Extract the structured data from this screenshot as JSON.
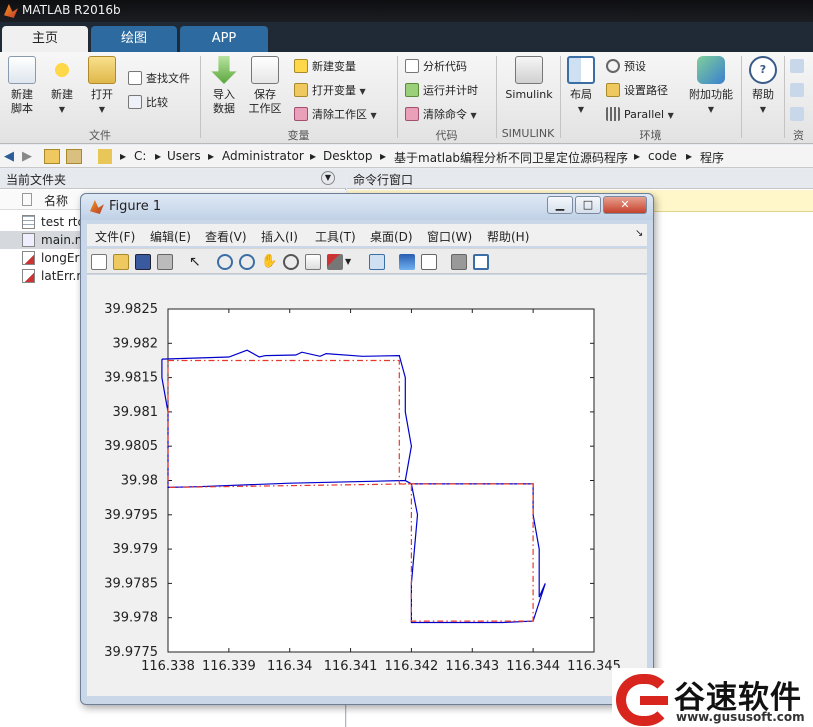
{
  "app": {
    "title": "MATLAB R2016b"
  },
  "tabs": [
    "主页",
    "绘图",
    "APP"
  ],
  "ribbon": {
    "new_script": "新建\n脚本",
    "new": "新建",
    "open": "打开",
    "find_files": "查找文件",
    "compare": "比较",
    "import": "导入\n数据",
    "save_ws": "保存\n工作区",
    "new_var": "新建变量",
    "open_var": "打开变量",
    "clear_ws": "清除工作区",
    "analyze": "分析代码",
    "run_time": "运行并计时",
    "clear_cmd": "清除命令",
    "simulink": "Simulink",
    "layout": "布局",
    "prefs": "预设",
    "set_path": "设置路径",
    "parallel": "Parallel",
    "addons": "附加功能",
    "help": "帮助",
    "sections": [
      "文件",
      "变量",
      "代码",
      "SIMULINK",
      "环境",
      "资"
    ]
  },
  "address": {
    "segments": [
      "C:",
      "Users",
      "Administrator",
      "Desktop",
      "基于matlab编程分析不同卫星定位源码程序",
      "code",
      "程序"
    ]
  },
  "file_panel": {
    "title": "当前文件夹",
    "col_name": "名称",
    "files": [
      "test rtc",
      "main.m",
      "longEr",
      "latErr.m"
    ]
  },
  "cmd_panel": {
    "title": "命令行窗口"
  },
  "figure": {
    "title": "Figure 1",
    "menu": [
      "文件(F)",
      "编辑(E)",
      "查看(V)",
      "插入(I)",
      "工具(T)",
      "桌面(D)",
      "窗口(W)",
      "帮助(H)"
    ]
  },
  "colors": {
    "series_actual": "#0000cc",
    "series_ref": "#e8382a",
    "accent": "#2c6aa0"
  },
  "chart_data": {
    "type": "line",
    "xlim": [
      116.338,
      116.345
    ],
    "ylim": [
      39.9775,
      39.9825
    ],
    "xticks": [
      "116.338",
      "116.339",
      "116.34",
      "116.341",
      "116.342",
      "116.343",
      "116.344",
      "116.345"
    ],
    "yticks": [
      "39.9825",
      "39.982",
      "39.9815",
      "39.981",
      "39.9805",
      "39.98",
      "39.9795",
      "39.979",
      "39.9785",
      "39.978",
      "39.9775"
    ],
    "grid": false,
    "series": [
      {
        "style": "solid",
        "x": [
          116.3379,
          116.339,
          116.3393,
          116.3395,
          116.3396,
          116.3401,
          116.3402,
          116.3405,
          116.3406,
          116.3412,
          116.3418,
          116.3419,
          116.3419,
          116.342,
          116.3419,
          116.342,
          116.342,
          116.344,
          116.344,
          116.3441,
          116.3441,
          116.3442,
          116.344,
          116.3435,
          116.342,
          116.342,
          116.3421,
          116.342,
          116.3419,
          116.34,
          116.3385,
          116.338,
          116.338,
          116.3379,
          116.3379
        ],
        "y": [
          39.98177,
          39.9818,
          39.9819,
          39.9818,
          39.98182,
          39.98183,
          39.98187,
          39.98181,
          39.98185,
          39.98181,
          39.98182,
          39.9815,
          39.981,
          39.9805,
          39.98,
          39.97995,
          39.97995,
          39.97995,
          39.9795,
          39.979,
          39.9783,
          39.9785,
          39.97795,
          39.97793,
          39.97793,
          39.9785,
          39.9795,
          39.97995,
          39.98,
          39.97996,
          39.97991,
          39.9799,
          39.981,
          39.9815,
          39.98177
        ]
      },
      {
        "style": "dashdot",
        "x": [
          116.338,
          116.3418,
          116.3418,
          116.344,
          116.344,
          116.342,
          116.342,
          116.338,
          116.338
        ],
        "y": [
          39.98175,
          39.98175,
          39.97995,
          39.97995,
          39.97795,
          39.97795,
          39.97995,
          39.9799,
          39.98175
        ]
      }
    ]
  },
  "watermark": {
    "name": "谷速软件",
    "url": "www.gususoft.com"
  }
}
